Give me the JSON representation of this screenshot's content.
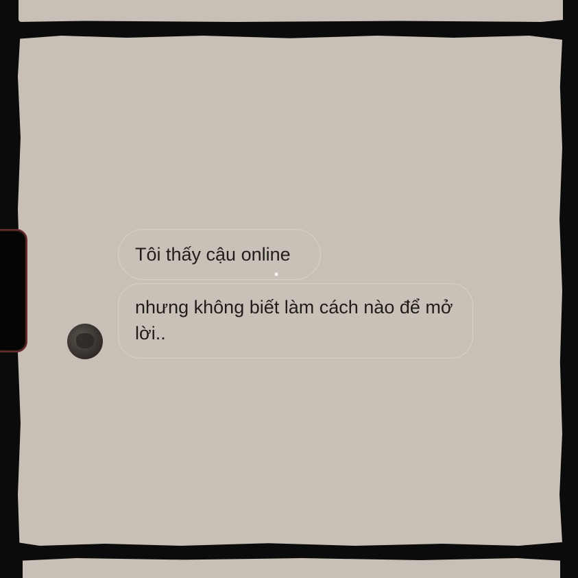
{
  "chat": {
    "messages": [
      {
        "text": "Tôi thấy cậu online"
      },
      {
        "text": "nhưng không biết làm cách nào để mở lời.."
      }
    ]
  },
  "colors": {
    "background": "#0b0b0b",
    "panel": "#c8c0b7",
    "bubble": "#c9c1b8",
    "text": "#1f1c1a"
  }
}
